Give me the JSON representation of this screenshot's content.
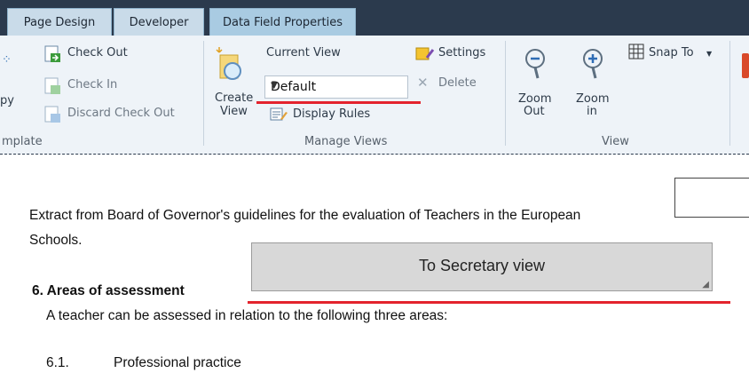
{
  "tabs": [
    {
      "label": "Page Design"
    },
    {
      "label": "Developer"
    },
    {
      "label": "Data Field Properties"
    }
  ],
  "ribbon": {
    "template_group": {
      "label": "mplate",
      "partial_label": "py",
      "check_out": "Check Out",
      "check_in": "Check In",
      "discard": "Discard Check Out"
    },
    "views_group": {
      "label": "Manage Views",
      "create_top": "Create",
      "create_bottom": "View",
      "current_view": "Current View",
      "selected_view": "Default",
      "display_rules": "Display Rules",
      "settings": "Settings",
      "delete": "Delete"
    },
    "view_group": {
      "label": "View",
      "zoom_out_top": "Zoom",
      "zoom_out_bottom": "Out",
      "zoom_in_top": "Zoom",
      "zoom_in_bottom": "in",
      "snap_to": "Snap To"
    }
  },
  "document": {
    "intro_line1": "Extract from Board of Governor's guidelines for the evaluation of Teachers in the European",
    "intro_line2": "Schools.",
    "button_label": "To Secretary view",
    "heading": "6. Areas of assessment",
    "body": "A teacher can be assessed in relation to the following three areas:",
    "item_number": "6.1.",
    "item_text": "Professional practice"
  },
  "colors": {
    "tab_bar": "#2b3a4d",
    "active_tab": "#a9cbe2",
    "annotation_red": "#e3232d"
  }
}
